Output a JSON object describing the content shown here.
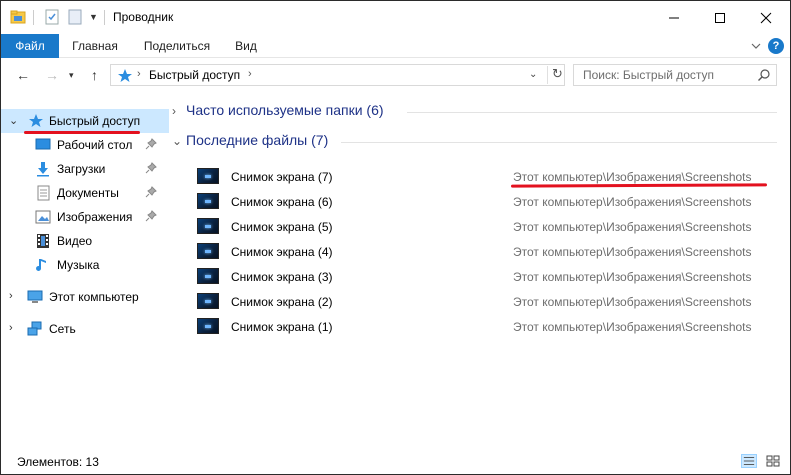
{
  "window": {
    "title": "Проводник"
  },
  "ribbon": {
    "tabs": [
      "Файл",
      "Главная",
      "Поделиться",
      "Вид"
    ],
    "help_label": "?"
  },
  "address": {
    "path": "Быстрый доступ",
    "search_placeholder": "Поиск: Быстрый доступ"
  },
  "nav_pane": {
    "quick_access": "Быстрый доступ",
    "items": [
      {
        "label": "Рабочий стол",
        "icon": "desktop-icon",
        "pinned": true
      },
      {
        "label": "Загрузки",
        "icon": "downloads-icon",
        "pinned": true
      },
      {
        "label": "Документы",
        "icon": "documents-icon",
        "pinned": true
      },
      {
        "label": "Изображения",
        "icon": "pictures-icon",
        "pinned": true
      },
      {
        "label": "Видео",
        "icon": "videos-icon",
        "pinned": false
      },
      {
        "label": "Музыка",
        "icon": "music-icon",
        "pinned": false
      }
    ],
    "this_pc": "Этот компьютер",
    "network": "Сеть"
  },
  "content": {
    "frequent_group": "Часто используемые папки (6)",
    "recent_group": "Последние файлы (7)",
    "files": [
      {
        "name": "Снимок экрана (7)",
        "path": "Этот компьютер\\Изображения\\Screenshots"
      },
      {
        "name": "Снимок экрана (6)",
        "path": "Этот компьютер\\Изображения\\Screenshots"
      },
      {
        "name": "Снимок экрана (5)",
        "path": "Этот компьютер\\Изображения\\Screenshots"
      },
      {
        "name": "Снимок экрана (4)",
        "path": "Этот компьютер\\Изображения\\Screenshots"
      },
      {
        "name": "Снимок экрана (3)",
        "path": "Этот компьютер\\Изображения\\Screenshots"
      },
      {
        "name": "Снимок экрана (2)",
        "path": "Этот компьютер\\Изображения\\Screenshots"
      },
      {
        "name": "Снимок экрана (1)",
        "path": "Этот компьютер\\Изображения\\Screenshots"
      }
    ]
  },
  "status": {
    "items_count": "Элементов: 13"
  },
  "colors": {
    "accent": "#1979ca",
    "selection": "#cce8ff",
    "group_heading": "#1e3287",
    "annotation_red": "#e3111f"
  }
}
